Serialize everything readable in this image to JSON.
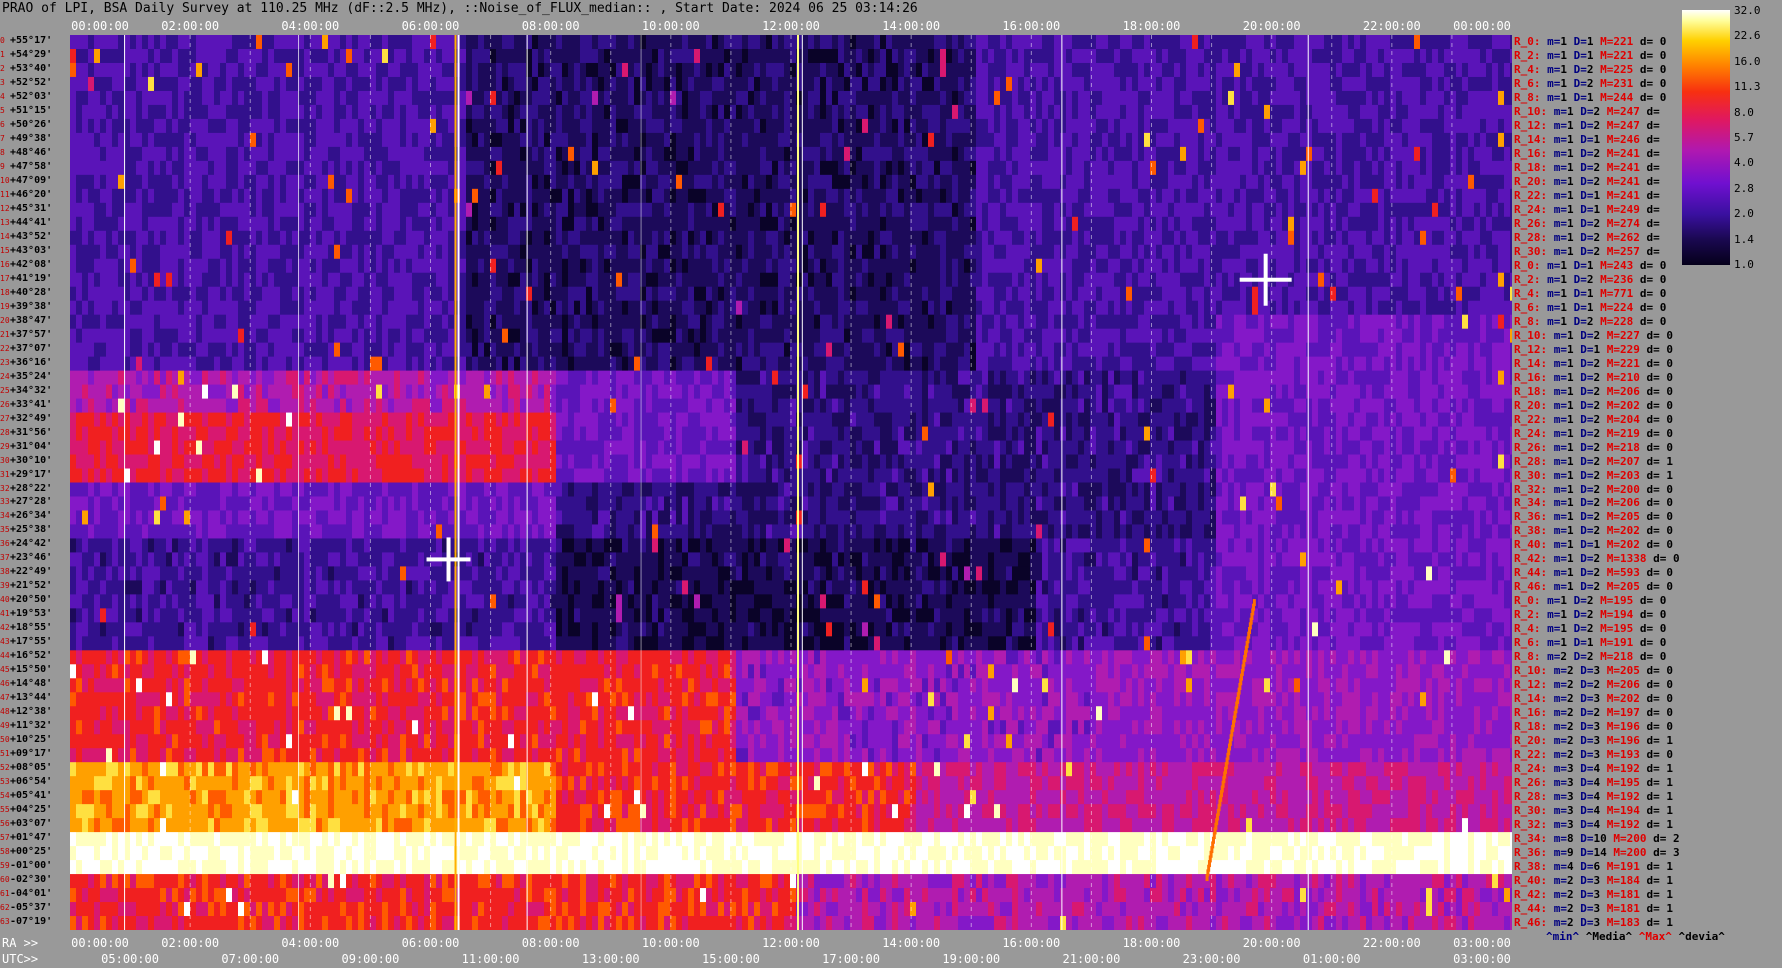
{
  "chart_data": {
    "type": "heatmap",
    "title": "PRAO of LPI, BSA Daily Survey at 110.25 MHz (dF::2.5 MHz), ::Noise_of_FLUX_median:: , Start Date: 2024 06 25 03:14:26",
    "x_top_ticks": [
      "00:00:00",
      "02:00:00",
      "04:00:00",
      "06:00:00",
      "08:00:00",
      "10:00:00",
      "12:00:00",
      "14:00:00",
      "16:00:00",
      "18:00:00",
      "20:00:00",
      "22:00:00",
      "00:00:00"
    ],
    "x_ra_ticks": [
      "00:00:00",
      "02:00:00",
      "04:00:00",
      "06:00:00",
      "08:00:00",
      "10:00:00",
      "12:00:00",
      "14:00:00",
      "16:00:00",
      "18:00:00",
      "20:00:00",
      "22:00:00",
      "03:00:00"
    ],
    "x_utc_ticks": [
      "05:00:00",
      "07:00:00",
      "09:00:00",
      "11:00:00",
      "13:00:00",
      "15:00:00",
      "17:00:00",
      "19:00:00",
      "21:00:00",
      "23:00:00",
      "01:00:00",
      "03:00:00"
    ],
    "ra_prefix": "RA >>",
    "utc_prefix": "UTC>>",
    "colorbar": {
      "labels": [
        "32.0",
        "22.6",
        "16.0",
        "11.3",
        "8.0",
        "5.7",
        "4.0",
        "2.8",
        "2.0",
        "1.4",
        "1.0"
      ],
      "scale": "log"
    },
    "declinations": [
      "+55°17'",
      "+54°29'",
      "+53°40'",
      "+52°52'",
      "+52°03'",
      "+51°15'",
      "+50°26'",
      "+49°38'",
      "+48°46'",
      "+47°58'",
      "+47°09'",
      "+46°20'",
      "+45°31'",
      "+44°41'",
      "+43°52'",
      "+43°03'",
      "+42°08'",
      "+41°19'",
      "+40°28'",
      "+39°38'",
      "+38°47'",
      "+37°57'",
      "+37°07'",
      "+36°16'",
      "+35°24'",
      "+34°32'",
      "+33°41'",
      "+32°49'",
      "+31°56'",
      "+31°04'",
      "+30°10'",
      "+29°17'",
      "+28°22'",
      "+27°28'",
      "+26°34'",
      "+25°38'",
      "+24°42'",
      "+23°46'",
      "+22°49'",
      "+21°52'",
      "+20°50'",
      "+19°53'",
      "+18°55'",
      "+17°55'",
      "+16°52'",
      "+15°50'",
      "+14°48'",
      "+13°44'",
      "+12°38'",
      "+11°32'",
      "+10°25'",
      "+09°17'",
      "+08°05'",
      "+06°54'",
      "+05°41'",
      "+04°25'",
      "+03°07'",
      "+01°47'",
      "+00°25'",
      "-01°00'",
      "-02°30'",
      "-04°01'",
      "-05°37'",
      "-07°19'"
    ],
    "stats": [
      [
        "R_0:",
        "1",
        "1",
        "221",
        "0"
      ],
      [
        "R_2:",
        "1",
        "1",
        "221",
        "0"
      ],
      [
        "R_4:",
        "1",
        "2",
        "225",
        "0"
      ],
      [
        "R_6:",
        "1",
        "2",
        "231",
        "0"
      ],
      [
        "R_8:",
        "1",
        "1",
        "244",
        "0"
      ],
      [
        "R_10:",
        "1",
        "2",
        "247",
        ""
      ],
      [
        "R_12:",
        "1",
        "2",
        "247",
        ""
      ],
      [
        "R_14:",
        "1",
        "1",
        "246",
        ""
      ],
      [
        "R_16:",
        "1",
        "2",
        "241",
        ""
      ],
      [
        "R_18:",
        "1",
        "2",
        "241",
        ""
      ],
      [
        "R_20:",
        "1",
        "2",
        "241",
        ""
      ],
      [
        "R_22:",
        "1",
        "1",
        "241",
        ""
      ],
      [
        "R_24:",
        "1",
        "1",
        "249",
        ""
      ],
      [
        "R_26:",
        "1",
        "2",
        "274",
        ""
      ],
      [
        "R_28:",
        "1",
        "2",
        "262",
        ""
      ],
      [
        "R_30:",
        "1",
        "2",
        "257",
        ""
      ],
      [
        "R_0:",
        "1",
        "1",
        "243",
        "0"
      ],
      [
        "R_2:",
        "1",
        "2",
        "236",
        "0"
      ],
      [
        "R_4:",
        "1",
        "1",
        "771",
        "0"
      ],
      [
        "R_6:",
        "1",
        "1",
        "224",
        "0"
      ],
      [
        "R_8:",
        "1",
        "2",
        "228",
        "0"
      ],
      [
        "R_10:",
        "1",
        "2",
        "227",
        "0"
      ],
      [
        "R_12:",
        "1",
        "1",
        "229",
        "0"
      ],
      [
        "R_14:",
        "1",
        "2",
        "221",
        "0"
      ],
      [
        "R_16:",
        "1",
        "2",
        "210",
        "0"
      ],
      [
        "R_18:",
        "1",
        "2",
        "206",
        "0"
      ],
      [
        "R_20:",
        "1",
        "2",
        "202",
        "0"
      ],
      [
        "R_22:",
        "1",
        "2",
        "204",
        "0"
      ],
      [
        "R_24:",
        "1",
        "2",
        "219",
        "0"
      ],
      [
        "R_26:",
        "1",
        "2",
        "218",
        "0"
      ],
      [
        "R_28:",
        "1",
        "2",
        "207",
        "1"
      ],
      [
        "R_30:",
        "1",
        "2",
        "203",
        "1"
      ],
      [
        "R_32:",
        "1",
        "2",
        "200",
        "0"
      ],
      [
        "R_34:",
        "1",
        "2",
        "206",
        "0"
      ],
      [
        "R_36:",
        "1",
        "2",
        "205",
        "0"
      ],
      [
        "R_38:",
        "1",
        "2",
        "202",
        "0"
      ],
      [
        "R_40:",
        "1",
        "1",
        "202",
        "0"
      ],
      [
        "R_42:",
        "1",
        "2",
        "1338",
        "0"
      ],
      [
        "R_44:",
        "1",
        "2",
        "593",
        "0"
      ],
      [
        "R_46:",
        "1",
        "2",
        "205",
        "0"
      ],
      [
        "R_0:",
        "1",
        "2",
        "195",
        "0"
      ],
      [
        "R_2:",
        "1",
        "2",
        "194",
        "0"
      ],
      [
        "R_4:",
        "1",
        "2",
        "195",
        "0"
      ],
      [
        "R_6:",
        "1",
        "1",
        "191",
        "0"
      ],
      [
        "R_8:",
        "2",
        "2",
        "218",
        "0"
      ],
      [
        "R_10:",
        "2",
        "3",
        "205",
        "0"
      ],
      [
        "R_12:",
        "2",
        "2",
        "206",
        "0"
      ],
      [
        "R_14:",
        "2",
        "3",
        "202",
        "0"
      ],
      [
        "R_16:",
        "2",
        "2",
        "197",
        "0"
      ],
      [
        "R_18:",
        "2",
        "3",
        "196",
        "0"
      ],
      [
        "R_20:",
        "2",
        "3",
        "196",
        "1"
      ],
      [
        "R_22:",
        "2",
        "3",
        "193",
        "0"
      ],
      [
        "R_24:",
        "3",
        "4",
        "192",
        "1"
      ],
      [
        "R_26:",
        "3",
        "4",
        "195",
        "1"
      ],
      [
        "R_28:",
        "3",
        "4",
        "192",
        "1"
      ],
      [
        "R_30:",
        "3",
        "4",
        "194",
        "1"
      ],
      [
        "R_32:",
        "3",
        "4",
        "192",
        "1"
      ],
      [
        "R_34:",
        "8",
        "10",
        "200",
        "2"
      ],
      [
        "R_36:",
        "9",
        "14",
        "200",
        "3"
      ],
      [
        "R_38:",
        "4",
        "6",
        "191",
        "1"
      ],
      [
        "R_40:",
        "2",
        "3",
        "184",
        "1"
      ],
      [
        "R_42:",
        "2",
        "3",
        "181",
        "1"
      ],
      [
        "R_44:",
        "2",
        "3",
        "181",
        "1"
      ],
      [
        "R_46:",
        "2",
        "3",
        "183",
        "1"
      ]
    ],
    "legend": {
      "min": "^min^",
      "median": "^Media^",
      "max": "^Max^",
      "devia": "^devia^"
    }
  }
}
